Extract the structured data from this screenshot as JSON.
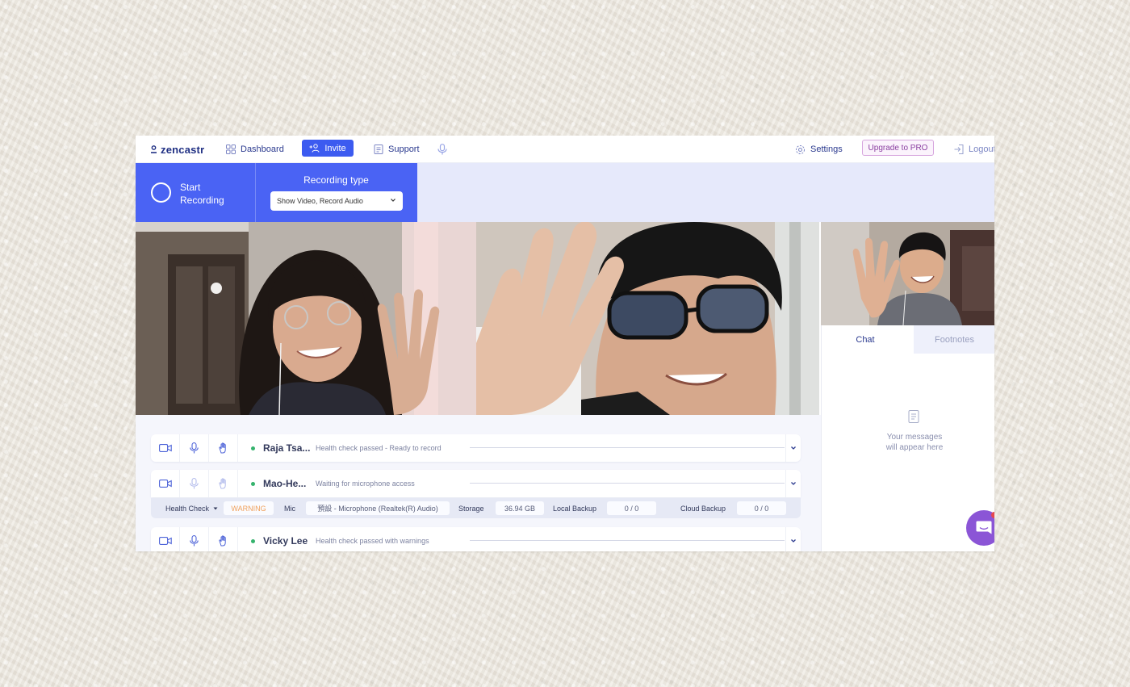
{
  "nav": {
    "logo": "zencastr",
    "dashboard": "Dashboard",
    "invite": "Invite",
    "support": "Support",
    "settings": "Settings",
    "upgrade": "Upgrade to PRO",
    "logout": "Logout"
  },
  "recording": {
    "start_line1": "Start",
    "start_line2": "Recording",
    "type_title": "Recording type",
    "type_value": "Show Video, Record Audio"
  },
  "chat": {
    "tab_chat": "Chat",
    "tab_footnotes": "Footnotes",
    "empty_line1": "Your messages",
    "empty_line2": "will appear here"
  },
  "participants": [
    {
      "name": "Raja Tsa...",
      "status": "Health check passed - Ready to record"
    },
    {
      "name": "Mao-He...",
      "status": "Waiting for microphone access"
    },
    {
      "name": "Vicky Lee",
      "status": "Health check passed with warnings"
    }
  ],
  "details": {
    "health_label": "Health Check",
    "health_value": "WARNING",
    "mic_label": "Mic",
    "mic_value": "預設 - Microphone (Realtek(R) Audio)",
    "storage_label": "Storage",
    "storage_value": "36.94 GB",
    "local_label": "Local Backup",
    "local_value": "0 / 0",
    "cloud_label": "Cloud Backup",
    "cloud_value": "0 / 0"
  },
  "colors": {
    "accent": "#4a63f4",
    "nav_text": "#2b3a8f",
    "warning": "#f0a15c",
    "status_ok": "#35b36d",
    "launcher": "#8b55d6"
  }
}
